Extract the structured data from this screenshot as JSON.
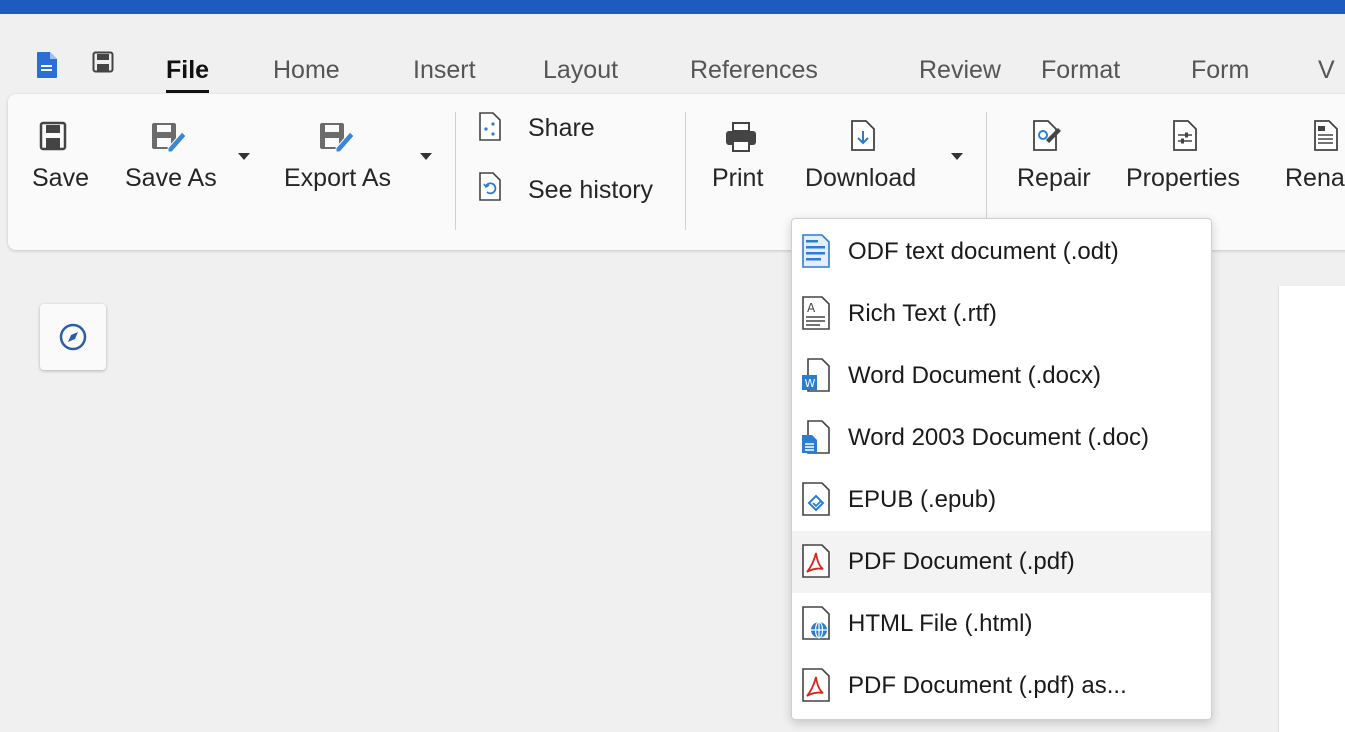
{
  "tabs": [
    {
      "label": "File",
      "active": true
    },
    {
      "label": "Home"
    },
    {
      "label": "Insert"
    },
    {
      "label": "Layout"
    },
    {
      "label": "References"
    },
    {
      "label": "Review"
    },
    {
      "label": "Format"
    },
    {
      "label": "Form"
    },
    {
      "label": "V"
    }
  ],
  "ribbon": {
    "save": "Save",
    "save_as": "Save As",
    "export_as": "Export As",
    "share": "Share",
    "see_history": "See history",
    "print": "Print",
    "download": "Download",
    "repair": "Repair",
    "properties": "Properties",
    "rename": "Rena"
  },
  "download_menu": {
    "items": [
      {
        "label": "ODF text document (.odt)",
        "icon": "odt-file-icon"
      },
      {
        "label": "Rich Text (.rtf)",
        "icon": "rtf-file-icon"
      },
      {
        "label": "Word Document (.docx)",
        "icon": "docx-file-icon"
      },
      {
        "label": "Word 2003 Document (.doc)",
        "icon": "doc-file-icon"
      },
      {
        "label": "EPUB (.epub)",
        "icon": "epub-file-icon"
      },
      {
        "label": "PDF Document (.pdf)",
        "icon": "pdf-file-icon",
        "hovered": true
      },
      {
        "label": "HTML File (.html)",
        "icon": "html-file-icon"
      },
      {
        "label": "PDF Document (.pdf) as...",
        "icon": "pdf-file-icon"
      }
    ]
  },
  "colors": {
    "accent": "#1e5bbf",
    "pdf_red": "#d9261c",
    "word_blue": "#2b7cd3"
  }
}
